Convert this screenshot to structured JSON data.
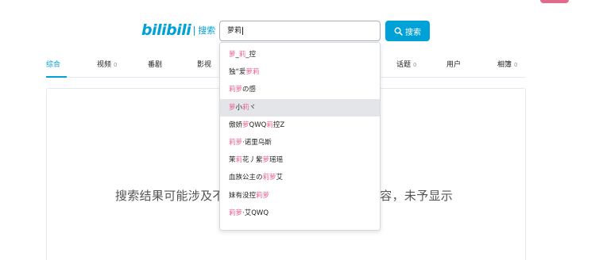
{
  "header": {
    "logo_text": "bilibili",
    "logo_sub": "搜索"
  },
  "search": {
    "value": "萝莉",
    "button_label": "搜索"
  },
  "tabs": [
    {
      "label": "综合",
      "count": "",
      "active": true
    },
    {
      "label": "视频",
      "count": "0",
      "active": false
    },
    {
      "label": "番剧",
      "count": "",
      "active": false
    },
    {
      "label": "影视",
      "count": "",
      "active": false
    },
    {
      "label": "话题",
      "count": "0",
      "active": false
    },
    {
      "label": "用户",
      "count": "",
      "active": false
    },
    {
      "label": "相簿",
      "count": "0",
      "active": false
    }
  ],
  "suggestions": [
    [
      {
        "t": "萝",
        "k": true
      },
      {
        "t": "_",
        "k": false
      },
      {
        "t": "莉",
        "k": true
      },
      {
        "t": "_控",
        "k": false
      }
    ],
    [
      {
        "t": "独“爱",
        "k": false
      },
      {
        "t": "萝莉",
        "k": true
      }
    ],
    [
      {
        "t": "莉萝",
        "k": true
      },
      {
        "t": "の感",
        "k": false
      }
    ],
    [
      {
        "t": "萝",
        "k": true
      },
      {
        "t": "小",
        "k": false
      },
      {
        "t": "莉",
        "k": true
      },
      {
        "t": "ヾ",
        "k": false
      }
    ],
    [
      {
        "t": "傲娇",
        "k": false
      },
      {
        "t": "萝",
        "k": true
      },
      {
        "t": "QWQ",
        "k": false
      },
      {
        "t": "莉",
        "k": true
      },
      {
        "t": "控Z",
        "k": false
      }
    ],
    [
      {
        "t": "莉萝",
        "k": true
      },
      {
        "t": "·诺里乌斯",
        "k": false
      }
    ],
    [
      {
        "t": "茉",
        "k": false
      },
      {
        "t": "莉",
        "k": true
      },
      {
        "t": "花丿紫",
        "k": false
      },
      {
        "t": "萝",
        "k": true
      },
      {
        "t": "瑶瑶",
        "k": false
      }
    ],
    [
      {
        "t": "血族公主の",
        "k": false
      },
      {
        "t": "莉萝",
        "k": true
      },
      {
        "t": "艾",
        "k": false
      }
    ],
    [
      {
        "t": "妹有没控",
        "k": false
      },
      {
        "t": "莉萝",
        "k": true
      }
    ],
    [
      {
        "t": "莉萝",
        "k": true
      },
      {
        "t": "·艾QWQ",
        "k": false
      }
    ]
  ],
  "highlighted_index": 3,
  "notice": {
    "head": "搜索结果可能涉及不",
    "tail": "内容，未予显示"
  }
}
